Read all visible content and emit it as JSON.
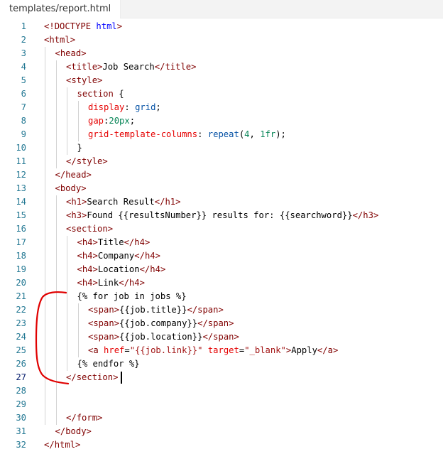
{
  "tab": {
    "label": "templates/report.html"
  },
  "lines": [
    {
      "n": "1",
      "indent": 0,
      "tokens": [
        [
          "t-pun",
          "<!"
        ],
        [
          "t-tag",
          "DOCTYPE"
        ],
        [
          "t-txt",
          " "
        ],
        [
          "t-attr2",
          "html"
        ],
        [
          "t-pun",
          ">"
        ]
      ]
    },
    {
      "n": "2",
      "indent": 0,
      "tokens": [
        [
          "t-pun",
          "<"
        ],
        [
          "t-tag",
          "html"
        ],
        [
          "t-pun",
          ">"
        ]
      ]
    },
    {
      "n": "3",
      "indent": 1,
      "tokens": [
        [
          "t-pun",
          "<"
        ],
        [
          "t-tag",
          "head"
        ],
        [
          "t-pun",
          ">"
        ]
      ]
    },
    {
      "n": "4",
      "indent": 2,
      "tokens": [
        [
          "t-pun",
          "<"
        ],
        [
          "t-tag",
          "title"
        ],
        [
          "t-pun",
          ">"
        ],
        [
          "t-txt",
          "Job Search"
        ],
        [
          "t-pun",
          "</"
        ],
        [
          "t-tag",
          "title"
        ],
        [
          "t-pun",
          ">"
        ]
      ]
    },
    {
      "n": "5",
      "indent": 2,
      "tokens": [
        [
          "t-pun",
          "<"
        ],
        [
          "t-tag",
          "style"
        ],
        [
          "t-pun",
          ">"
        ]
      ]
    },
    {
      "n": "6",
      "indent": 3,
      "tokens": [
        [
          "t-sel",
          "section"
        ],
        [
          "t-txt",
          " {"
        ]
      ]
    },
    {
      "n": "7",
      "indent": 4,
      "tokens": [
        [
          "t-prop",
          "display"
        ],
        [
          "t-txt",
          ": "
        ],
        [
          "t-val",
          "grid"
        ],
        [
          "t-txt",
          ";"
        ]
      ]
    },
    {
      "n": "8",
      "indent": 4,
      "tokens": [
        [
          "t-prop",
          "gap"
        ],
        [
          "t-txt",
          ":"
        ],
        [
          "t-num",
          "20px"
        ],
        [
          "t-txt",
          ";"
        ]
      ]
    },
    {
      "n": "9",
      "indent": 4,
      "tokens": [
        [
          "t-prop",
          "grid-template-columns"
        ],
        [
          "t-txt",
          ": "
        ],
        [
          "t-val",
          "repeat"
        ],
        [
          "t-txt",
          "("
        ],
        [
          "t-num",
          "4"
        ],
        [
          "t-txt",
          ", "
        ],
        [
          "t-num",
          "1fr"
        ],
        [
          "t-txt",
          ");"
        ]
      ]
    },
    {
      "n": "10",
      "indent": 3,
      "tokens": [
        [
          "t-txt",
          "}"
        ]
      ]
    },
    {
      "n": "11",
      "indent": 2,
      "tokens": [
        [
          "t-pun",
          "</"
        ],
        [
          "t-tag",
          "style"
        ],
        [
          "t-pun",
          ">"
        ]
      ]
    },
    {
      "n": "12",
      "indent": 1,
      "tokens": [
        [
          "t-pun",
          "</"
        ],
        [
          "t-tag",
          "head"
        ],
        [
          "t-pun",
          ">"
        ]
      ]
    },
    {
      "n": "13",
      "indent": 1,
      "tokens": [
        [
          "t-pun",
          "<"
        ],
        [
          "t-tag",
          "body"
        ],
        [
          "t-pun",
          ">"
        ]
      ]
    },
    {
      "n": "14",
      "indent": 2,
      "tokens": [
        [
          "t-pun",
          "<"
        ],
        [
          "t-tag",
          "h1"
        ],
        [
          "t-pun",
          ">"
        ],
        [
          "t-txt",
          "Search Result"
        ],
        [
          "t-pun",
          "</"
        ],
        [
          "t-tag",
          "h1"
        ],
        [
          "t-pun",
          ">"
        ]
      ]
    },
    {
      "n": "15",
      "indent": 2,
      "tokens": [
        [
          "t-pun",
          "<"
        ],
        [
          "t-tag",
          "h3"
        ],
        [
          "t-pun",
          ">"
        ],
        [
          "t-txt",
          "Found {{resultsNumber}} results for: {{searchword}}"
        ],
        [
          "t-pun",
          "</"
        ],
        [
          "t-tag",
          "h3"
        ],
        [
          "t-pun",
          ">"
        ]
      ]
    },
    {
      "n": "16",
      "indent": 2,
      "tokens": [
        [
          "t-pun",
          "<"
        ],
        [
          "t-tag",
          "section"
        ],
        [
          "t-pun",
          ">"
        ]
      ]
    },
    {
      "n": "17",
      "indent": 3,
      "tokens": [
        [
          "t-pun",
          "<"
        ],
        [
          "t-tag",
          "h4"
        ],
        [
          "t-pun",
          ">"
        ],
        [
          "t-txt",
          "Title"
        ],
        [
          "t-pun",
          "</"
        ],
        [
          "t-tag",
          "h4"
        ],
        [
          "t-pun",
          ">"
        ]
      ]
    },
    {
      "n": "18",
      "indent": 3,
      "tokens": [
        [
          "t-pun",
          "<"
        ],
        [
          "t-tag",
          "h4"
        ],
        [
          "t-pun",
          ">"
        ],
        [
          "t-txt",
          "Company"
        ],
        [
          "t-pun",
          "</"
        ],
        [
          "t-tag",
          "h4"
        ],
        [
          "t-pun",
          ">"
        ]
      ]
    },
    {
      "n": "19",
      "indent": 3,
      "tokens": [
        [
          "t-pun",
          "<"
        ],
        [
          "t-tag",
          "h4"
        ],
        [
          "t-pun",
          ">"
        ],
        [
          "t-txt",
          "Location"
        ],
        [
          "t-pun",
          "</"
        ],
        [
          "t-tag",
          "h4"
        ],
        [
          "t-pun",
          ">"
        ]
      ]
    },
    {
      "n": "20",
      "indent": 3,
      "tokens": [
        [
          "t-pun",
          "<"
        ],
        [
          "t-tag",
          "h4"
        ],
        [
          "t-pun",
          ">"
        ],
        [
          "t-txt",
          "Link"
        ],
        [
          "t-pun",
          "</"
        ],
        [
          "t-tag",
          "h4"
        ],
        [
          "t-pun",
          ">"
        ]
      ]
    },
    {
      "n": "21",
      "indent": 3,
      "tokens": [
        [
          "t-txt",
          "{% for job in jobs %}"
        ]
      ]
    },
    {
      "n": "22",
      "indent": 4,
      "tokens": [
        [
          "t-pun",
          "<"
        ],
        [
          "t-tag",
          "span"
        ],
        [
          "t-pun",
          ">"
        ],
        [
          "t-txt",
          "{{job.title}}"
        ],
        [
          "t-pun",
          "</"
        ],
        [
          "t-tag",
          "span"
        ],
        [
          "t-pun",
          ">"
        ]
      ]
    },
    {
      "n": "23",
      "indent": 4,
      "tokens": [
        [
          "t-pun",
          "<"
        ],
        [
          "t-tag",
          "span"
        ],
        [
          "t-pun",
          ">"
        ],
        [
          "t-txt",
          "{{job.company}}"
        ],
        [
          "t-pun",
          "</"
        ],
        [
          "t-tag",
          "span"
        ],
        [
          "t-pun",
          ">"
        ]
      ]
    },
    {
      "n": "24",
      "indent": 4,
      "tokens": [
        [
          "t-pun",
          "<"
        ],
        [
          "t-tag",
          "span"
        ],
        [
          "t-pun",
          ">"
        ],
        [
          "t-txt",
          "{{job.location}}"
        ],
        [
          "t-pun",
          "</"
        ],
        [
          "t-tag",
          "span"
        ],
        [
          "t-pun",
          ">"
        ]
      ]
    },
    {
      "n": "25",
      "indent": 4,
      "tokens": [
        [
          "t-pun",
          "<"
        ],
        [
          "t-tag",
          "a"
        ],
        [
          "t-txt",
          " "
        ],
        [
          "t-attr",
          "href"
        ],
        [
          "t-txt",
          "="
        ],
        [
          "t-str",
          "\"{{job.link}}\""
        ],
        [
          "t-txt",
          " "
        ],
        [
          "t-attr",
          "target"
        ],
        [
          "t-txt",
          "="
        ],
        [
          "t-str",
          "\"_blank\""
        ],
        [
          "t-pun",
          ">"
        ],
        [
          "t-txt",
          "Apply"
        ],
        [
          "t-pun",
          "</"
        ],
        [
          "t-tag",
          "a"
        ],
        [
          "t-pun",
          ">"
        ]
      ]
    },
    {
      "n": "26",
      "indent": 3,
      "tokens": [
        [
          "t-txt",
          "{% endfor %}"
        ]
      ]
    },
    {
      "n": "27",
      "indent": 2,
      "tokens": [
        [
          "t-pun",
          "</"
        ],
        [
          "t-tag",
          "section"
        ],
        [
          "t-pun",
          ">"
        ]
      ]
    },
    {
      "n": "28",
      "indent": 0,
      "tokens": []
    },
    {
      "n": "29",
      "indent": 0,
      "tokens": []
    },
    {
      "n": "30",
      "indent": 2,
      "tokens": [
        [
          "t-pun",
          "</"
        ],
        [
          "t-tag",
          "form"
        ],
        [
          "t-pun",
          ">"
        ]
      ]
    },
    {
      "n": "31",
      "indent": 1,
      "tokens": [
        [
          "t-pun",
          "</"
        ],
        [
          "t-tag",
          "body"
        ],
        [
          "t-pun",
          ">"
        ]
      ]
    },
    {
      "n": "32",
      "indent": 0,
      "tokens": [
        [
          "t-pun",
          "</"
        ],
        [
          "t-tag",
          "html"
        ],
        [
          "t-pun",
          ">"
        ]
      ]
    }
  ],
  "active_line": "27",
  "colors": {
    "annotation": "#e00000",
    "line_number": "#237893",
    "tag": "#800000",
    "attribute": "#e50000",
    "string": "#a31515",
    "value": "#0451a5"
  }
}
